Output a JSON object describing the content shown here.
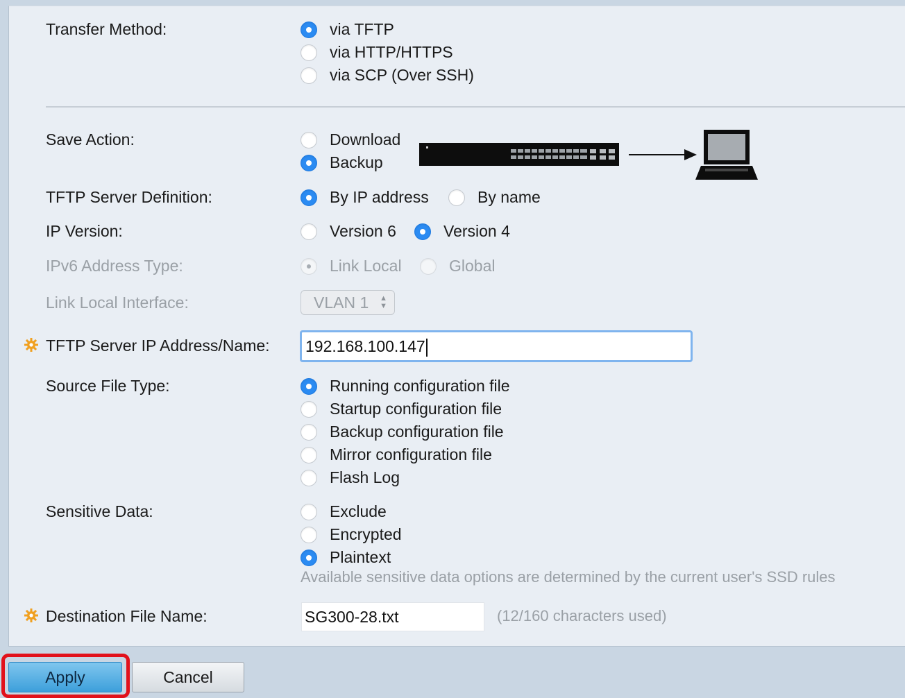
{
  "transfer_method": {
    "label": "Transfer Method:",
    "options": [
      "via TFTP",
      "via HTTP/HTTPS",
      "via SCP (Over SSH)"
    ],
    "selected": "via TFTP"
  },
  "save_action": {
    "label": "Save Action:",
    "options": [
      "Download",
      "Backup"
    ],
    "selected": "Backup"
  },
  "tftp_server_definition": {
    "label": "TFTP Server Definition:",
    "options": [
      "By IP address",
      "By name"
    ],
    "selected": "By IP address"
  },
  "ip_version": {
    "label": "IP Version:",
    "options": [
      "Version 6",
      "Version 4"
    ],
    "selected": "Version 4"
  },
  "ipv6_address_type": {
    "label": "IPv6 Address Type:",
    "options": [
      "Link Local",
      "Global"
    ],
    "selected": "Link Local",
    "disabled": true
  },
  "link_local_interface": {
    "label": "Link Local Interface:",
    "value": "VLAN 1",
    "disabled": true
  },
  "tftp_server_ip": {
    "label": "TFTP Server IP Address/Name:",
    "value": "192.168.100.147"
  },
  "source_file_type": {
    "label": "Source File Type:",
    "options": [
      "Running configuration file",
      "Startup configuration file",
      "Backup configuration file",
      "Mirror configuration file",
      "Flash Log"
    ],
    "selected": "Running configuration file"
  },
  "sensitive_data": {
    "label": "Sensitive Data:",
    "options": [
      "Exclude",
      "Encrypted",
      "Plaintext"
    ],
    "selected": "Plaintext",
    "note": "Available sensitive data options are determined by the current user's SSD rules"
  },
  "destination_file_name": {
    "label": "Destination File Name:",
    "value": "SG300-28.txt",
    "char_count": "(12/160 characters used)"
  },
  "buttons": {
    "apply": "Apply",
    "cancel": "Cancel"
  },
  "colors": {
    "radio_selected": "#2b8bf2",
    "highlight": "#e2111b",
    "required_icon": "#f0a020"
  },
  "icons": [
    "required-gear-icon",
    "switch-icon",
    "arrow-right-icon",
    "laptop-icon"
  ]
}
